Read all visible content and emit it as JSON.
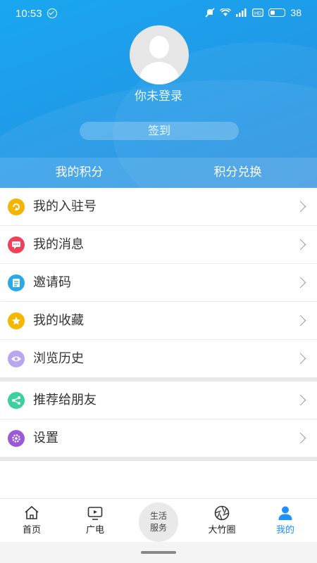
{
  "status_bar": {
    "time": "10:53",
    "battery": "38",
    "icons": [
      "check-circle-icon",
      "mute-icon",
      "wifi-icon",
      "signal-icon",
      "hd-icon",
      "battery-icon"
    ]
  },
  "profile": {
    "login_text": "你未登录",
    "signin_label": "签到"
  },
  "points": {
    "my_points": "我的积分",
    "redeem": "积分兑换"
  },
  "menu": [
    {
      "label": "我的入驻号",
      "icon": "account-icon",
      "color": "#f4b400"
    },
    {
      "label": "我的消息",
      "icon": "message-icon",
      "color": "#f0405a"
    },
    {
      "label": "邀请码",
      "icon": "invite-code-icon",
      "color": "#2aa8e8"
    },
    {
      "label": "我的收藏",
      "icon": "star-icon",
      "color": "#f5b800"
    },
    {
      "label": "浏览历史",
      "icon": "eye-icon",
      "color": "#b9a6f0"
    },
    {
      "label": "推荐给朋友",
      "icon": "share-icon",
      "color": "#3ccfa0"
    },
    {
      "label": "设置",
      "icon": "settings-icon",
      "color": "#9b59d9"
    }
  ],
  "bottom_nav": {
    "home": "首页",
    "tv": "广电",
    "life_line1": "生活",
    "life_line2": "服务",
    "circle": "大竹圈",
    "mine": "我的"
  },
  "colors": {
    "header_blue": "#1f9be8",
    "active_tab": "#1e90ff"
  }
}
